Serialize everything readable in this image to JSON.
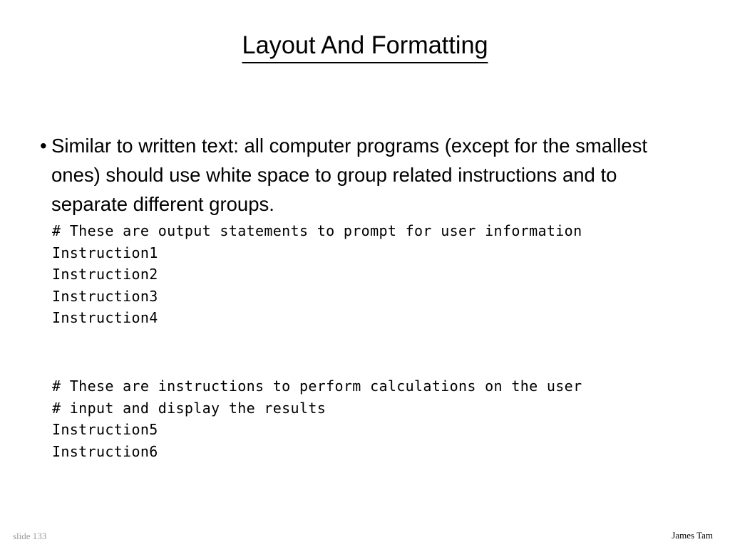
{
  "slide": {
    "title": "Layout And Formatting",
    "background_color": "#ffffff",
    "text_color": "#000000"
  },
  "body": {
    "bullets": [
      {
        "marker": "•",
        "text": "Similar to written text: all computer programs (except for the smallest ones) should use white space to group related instructions and to separate different groups."
      }
    ]
  },
  "code_blocks": [
    {
      "id": "code-block-1",
      "lines": [
        "# These are output statements to prompt for user information",
        "Instruction1",
        "Instruction2",
        "Instruction3",
        "Instruction4"
      ]
    },
    {
      "id": "code-block-2",
      "lines": [
        "# These are instructions to perform calculations on the user",
        "# input and display the results",
        "Instruction5",
        "Instruction6"
      ]
    }
  ],
  "footer": {
    "slide_number": "slide 133",
    "slide_number_color": "#9a9a9a",
    "author": "James Tam",
    "author_color": "#000000"
  }
}
